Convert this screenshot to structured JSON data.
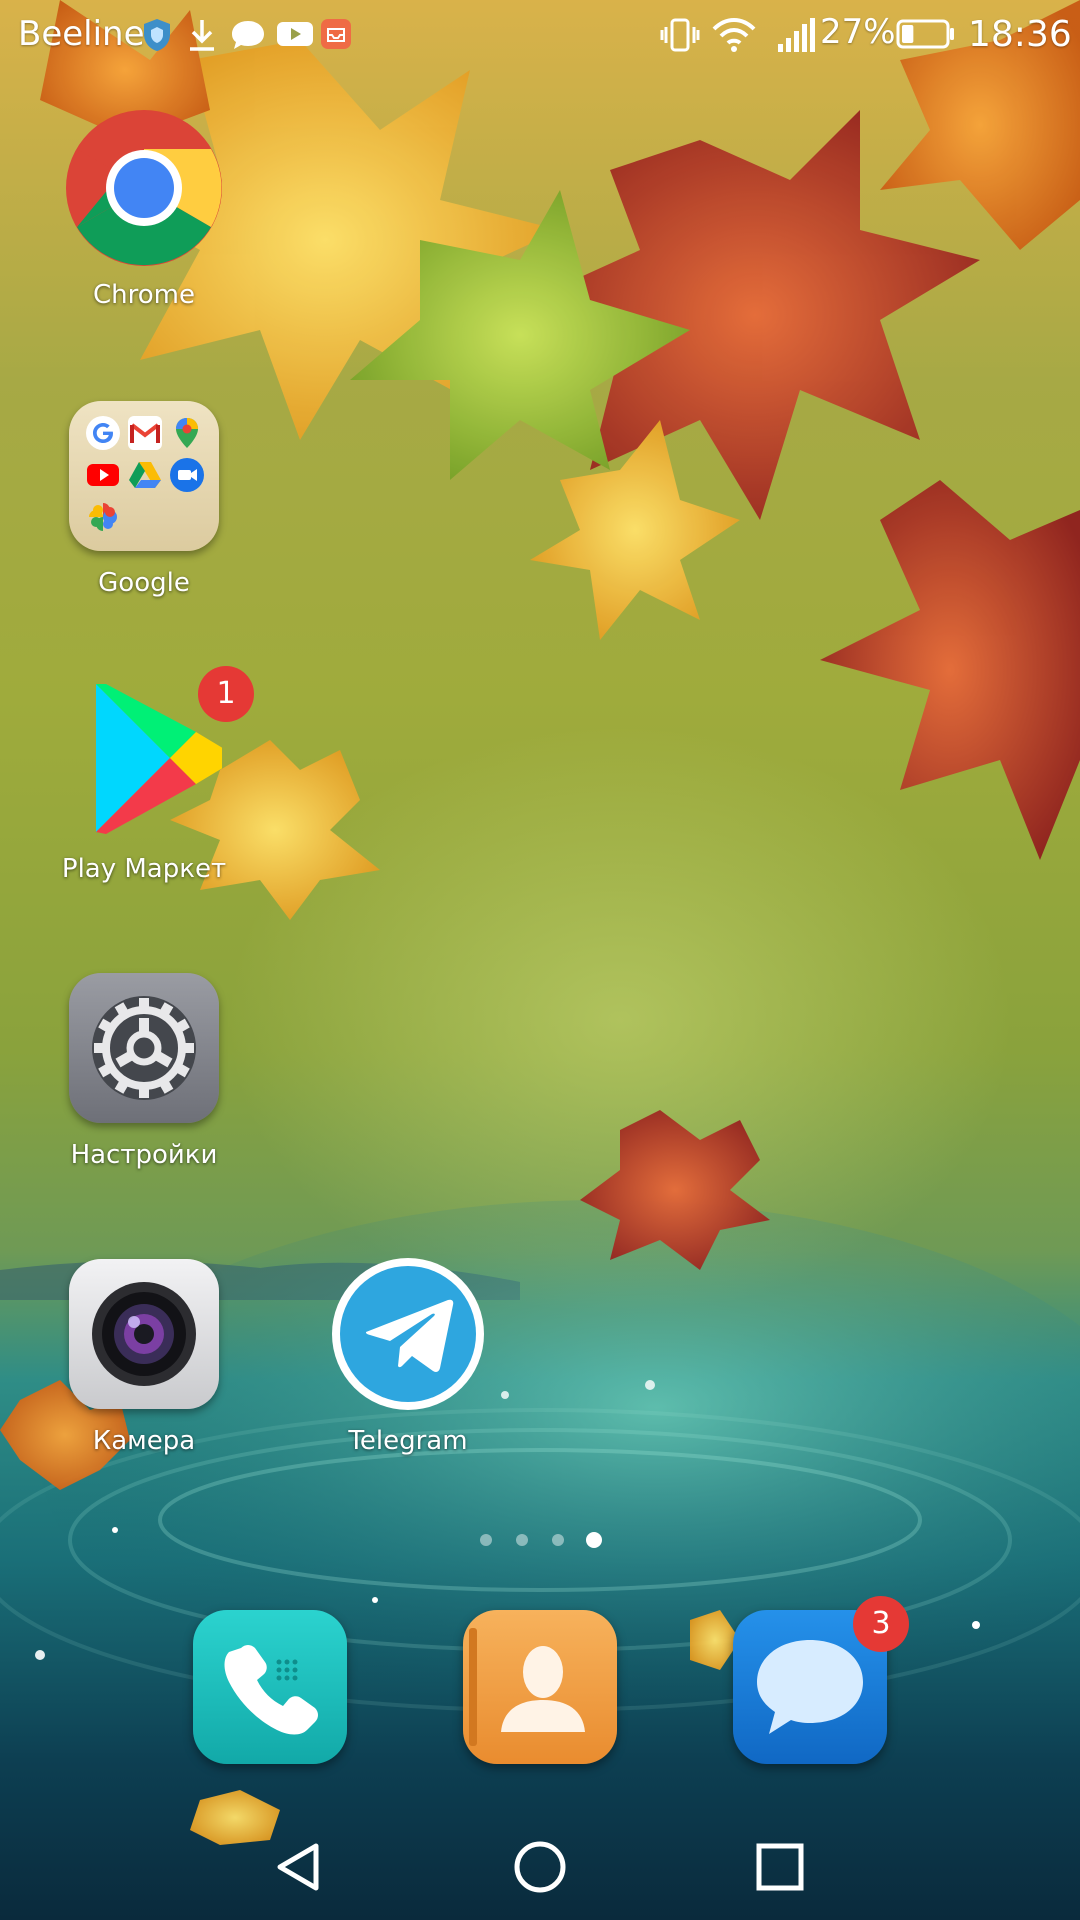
{
  "status_bar": {
    "carrier": "Beeline",
    "notification_icons": [
      "shield-icon",
      "download-icon",
      "chat-bubble-icon",
      "youtube-icon",
      "mail-tray-icon"
    ],
    "system_icons": [
      "vibrate-icon",
      "wifi-icon",
      "signal-icon",
      "battery-icon"
    ],
    "battery_percent": "27%",
    "battery_level": 0.27,
    "time": "18:36"
  },
  "home": {
    "apps": [
      {
        "label": "Chrome",
        "icon": "chrome-icon"
      },
      {
        "label": "Google",
        "icon": "folder-icon",
        "folder_apps": [
          "google-icon",
          "gmail-icon",
          "maps-icon",
          "youtube-icon",
          "drive-icon",
          "duo-icon",
          "photos-icon"
        ]
      },
      {
        "label": "Play Маркет",
        "icon": "play-store-icon",
        "badge": "1"
      },
      {
        "label": "Настройки",
        "icon": "settings-gear-icon"
      },
      {
        "label": "Камера",
        "icon": "camera-icon"
      },
      {
        "label": "Telegram",
        "icon": "telegram-icon"
      }
    ],
    "page_count": 4,
    "active_page": 4
  },
  "dock": {
    "apps": [
      {
        "icon": "phone-icon",
        "color": "#1fc1c0"
      },
      {
        "icon": "contacts-icon",
        "color": "#f2a14a"
      },
      {
        "icon": "messages-icon",
        "color": "#1b7fd8",
        "badge": "3"
      }
    ]
  },
  "nav_bar": {
    "buttons": [
      "back-icon",
      "home-icon",
      "recents-icon"
    ]
  },
  "colors": {
    "badge": "#e53935",
    "telegram": "#2ea6df"
  }
}
